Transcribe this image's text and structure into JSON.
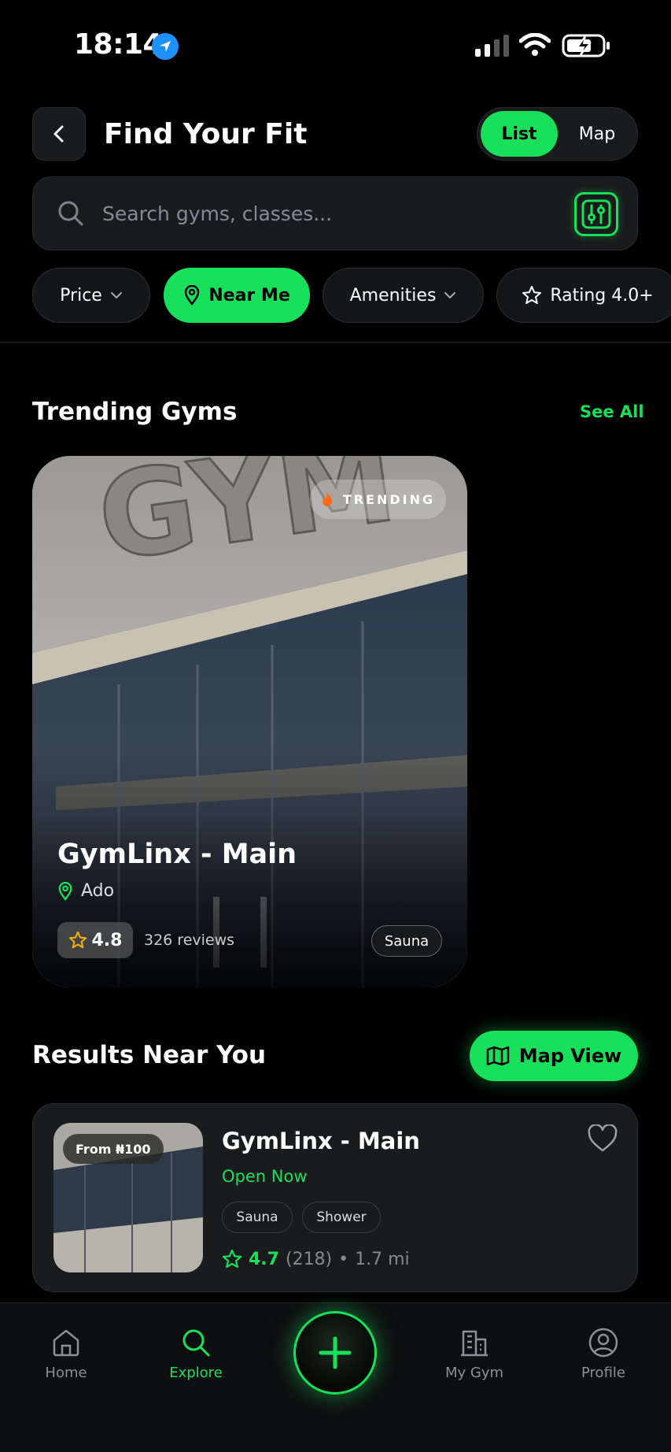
{
  "status_bar": {
    "time": "18:14"
  },
  "header": {
    "title": "Find Your Fit",
    "view_toggle": {
      "list": "List",
      "map": "Map",
      "selected": "List"
    }
  },
  "search": {
    "placeholder": "Search gyms, classes...",
    "value": ""
  },
  "filters": [
    {
      "label": "Price",
      "icon": "chevron-down-icon",
      "active": false
    },
    {
      "label": "Near Me",
      "icon": "location-pin-icon",
      "active": true
    },
    {
      "label": "Amenities",
      "icon": "chevron-down-icon",
      "active": false
    },
    {
      "label": "Rating 4.0+",
      "icon": "star-icon",
      "active": false
    }
  ],
  "trending": {
    "title": "Trending Gyms",
    "see_all": "See All",
    "card": {
      "badge": "TRENDING",
      "name": "GymLinx - Main",
      "location": "Ado",
      "rating": "4.8",
      "reviews": "326 reviews",
      "amenity": "Sauna"
    }
  },
  "results": {
    "title": "Results Near You",
    "map_view": "Map View",
    "items": [
      {
        "price": "From ₦100",
        "name": "GymLinx - Main",
        "status": "Open Now",
        "tags": [
          "Sauna",
          "Shower"
        ],
        "rating": "4.7",
        "review_count": "(218)",
        "separator": "•",
        "distance": "1.7 mi"
      }
    ]
  },
  "nav": {
    "home": "Home",
    "explore": "Explore",
    "my_gym": "My Gym",
    "profile": "Profile",
    "active": "Explore"
  },
  "colors": {
    "accent": "#18e05a",
    "background": "#000000",
    "card": "#1a1b1d"
  }
}
